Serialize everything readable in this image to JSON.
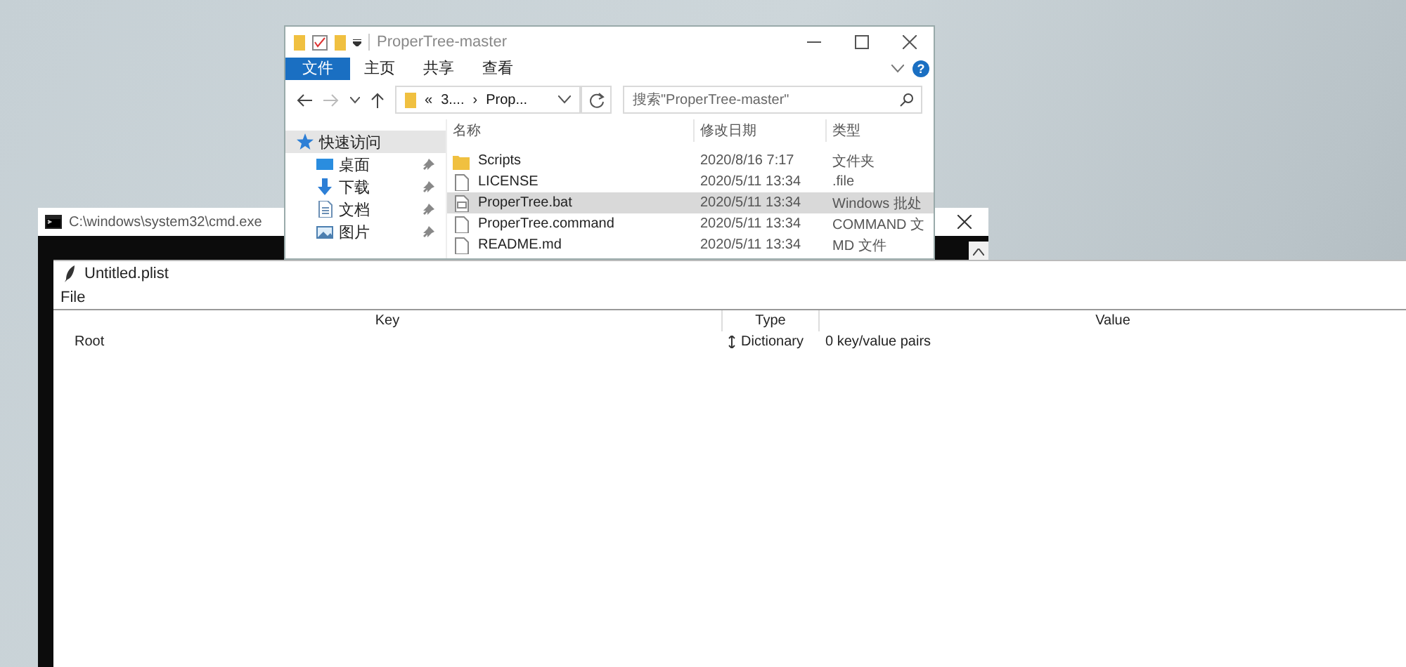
{
  "explorer": {
    "title": "ProperTree-master",
    "ribbon_tabs": [
      {
        "label": "文件",
        "selected": true
      },
      {
        "label": "主页",
        "selected": false
      },
      {
        "label": "共享",
        "selected": false
      },
      {
        "label": "查看",
        "selected": false
      }
    ],
    "help_button": "?",
    "address": [
      "«",
      "3....",
      "›",
      "Prop..."
    ],
    "search": {
      "placeholder": "搜索\"ProperTree-master\""
    },
    "sidebar": [
      {
        "label": "快速访问",
        "kind": "star",
        "pinned": false,
        "selected": true
      },
      {
        "label": "桌面",
        "kind": "desktop",
        "pinned": true,
        "selected": false
      },
      {
        "label": "下载",
        "kind": "download",
        "pinned": true,
        "selected": false
      },
      {
        "label": "文档",
        "kind": "document",
        "pinned": true,
        "selected": false
      },
      {
        "label": "图片",
        "kind": "picture",
        "pinned": true,
        "selected": false
      }
    ],
    "columns": [
      "名称",
      "修改日期",
      "类型"
    ],
    "files": [
      {
        "name": "Scripts",
        "modified": "2020/8/16 7:17",
        "type": "文件夹",
        "kind": "folder",
        "selected": false
      },
      {
        "name": "LICENSE",
        "modified": "2020/5/11 13:34",
        "type": ".file",
        "kind": "file",
        "selected": false
      },
      {
        "name": "ProperTree.bat",
        "modified": "2020/5/11 13:34",
        "type": "Windows 批处",
        "kind": "script",
        "selected": true
      },
      {
        "name": "ProperTree.command",
        "modified": "2020/5/11 13:34",
        "type": "COMMAND 文",
        "kind": "file",
        "selected": false
      },
      {
        "name": "README.md",
        "modified": "2020/5/11 13:34",
        "type": "MD 文件",
        "kind": "file",
        "selected": false
      }
    ]
  },
  "cmd": {
    "title": "C:\\windows\\system32\\cmd.exe"
  },
  "plist": {
    "title": "Untitled.plist",
    "menu": [
      "File"
    ],
    "columns": [
      "Key",
      "Type",
      "Value"
    ],
    "rows": [
      {
        "key": "Root",
        "type": "Dictionary",
        "value": "0 key/value pairs"
      }
    ]
  }
}
